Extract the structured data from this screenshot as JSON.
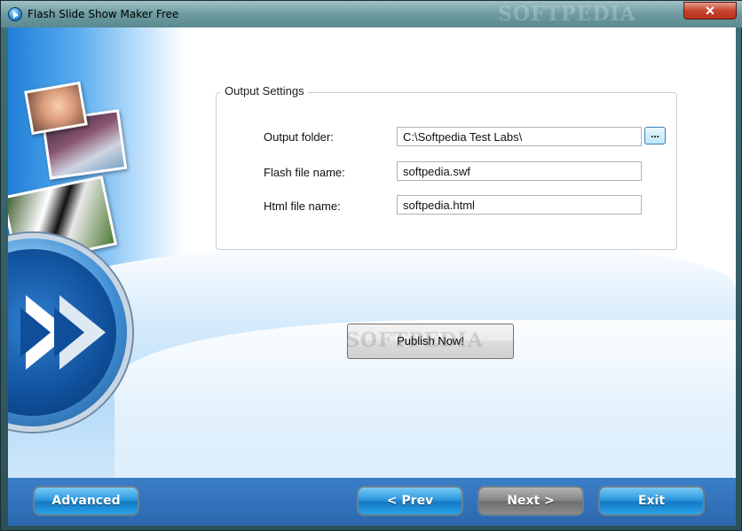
{
  "window": {
    "title": "Flash Slide Show Maker Free",
    "title_watermark": "SOFTPEDIA",
    "close_label": "✕"
  },
  "output_settings": {
    "legend": "Output Settings",
    "folder_label": "Output folder:",
    "folder_value": "C:\\Softpedia Test Labs\\",
    "browse_label": "...",
    "flash_label": "Flash file name:",
    "flash_value": "softpedia.swf",
    "html_label": "Html file name:",
    "html_value": "softpedia.html"
  },
  "publish": {
    "label": "Publish Now!",
    "watermark": "SOFTPEDIA"
  },
  "footer": {
    "advanced": "Advanced",
    "prev": "< Prev",
    "next": "Next >",
    "exit": "Exit"
  },
  "colors": {
    "accent_blue": "#2d9ae0",
    "disabled_grey": "#8a8a8a",
    "close_red": "#c8452e"
  },
  "icons": [
    "app-play-icon",
    "window-close-icon"
  ]
}
